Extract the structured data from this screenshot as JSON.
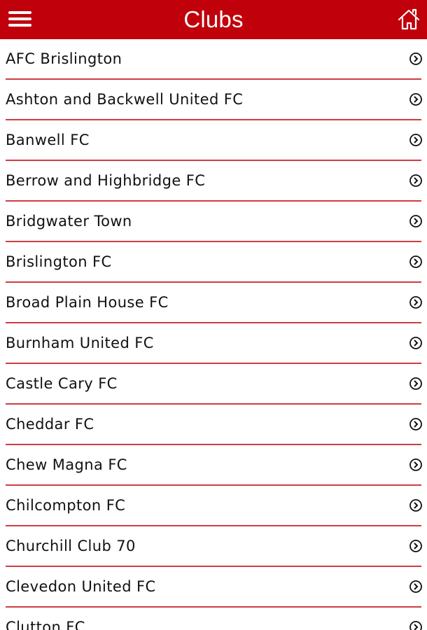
{
  "header": {
    "title": "Clubs",
    "menu_icon": "hamburger-menu-icon",
    "home_icon": "home-icon",
    "color": "#c0000b"
  },
  "clubs": [
    {
      "name": "AFC Brislington"
    },
    {
      "name": "Ashton and Backwell United FC"
    },
    {
      "name": "Banwell FC"
    },
    {
      "name": "Berrow and Highbridge FC"
    },
    {
      "name": "Bridgwater Town"
    },
    {
      "name": "Brislington FC"
    },
    {
      "name": "Broad Plain House FC"
    },
    {
      "name": "Burnham United FC"
    },
    {
      "name": "Castle Cary FC"
    },
    {
      "name": "Cheddar FC"
    },
    {
      "name": "Chew Magna FC"
    },
    {
      "name": "Chilcompton FC"
    },
    {
      "name": "Churchill Club 70"
    },
    {
      "name": "Clevedon United FC"
    },
    {
      "name": "Clutton FC"
    }
  ],
  "list_item_icon": "chevron-right-circle-icon",
  "divider_color": "#cf3d43"
}
